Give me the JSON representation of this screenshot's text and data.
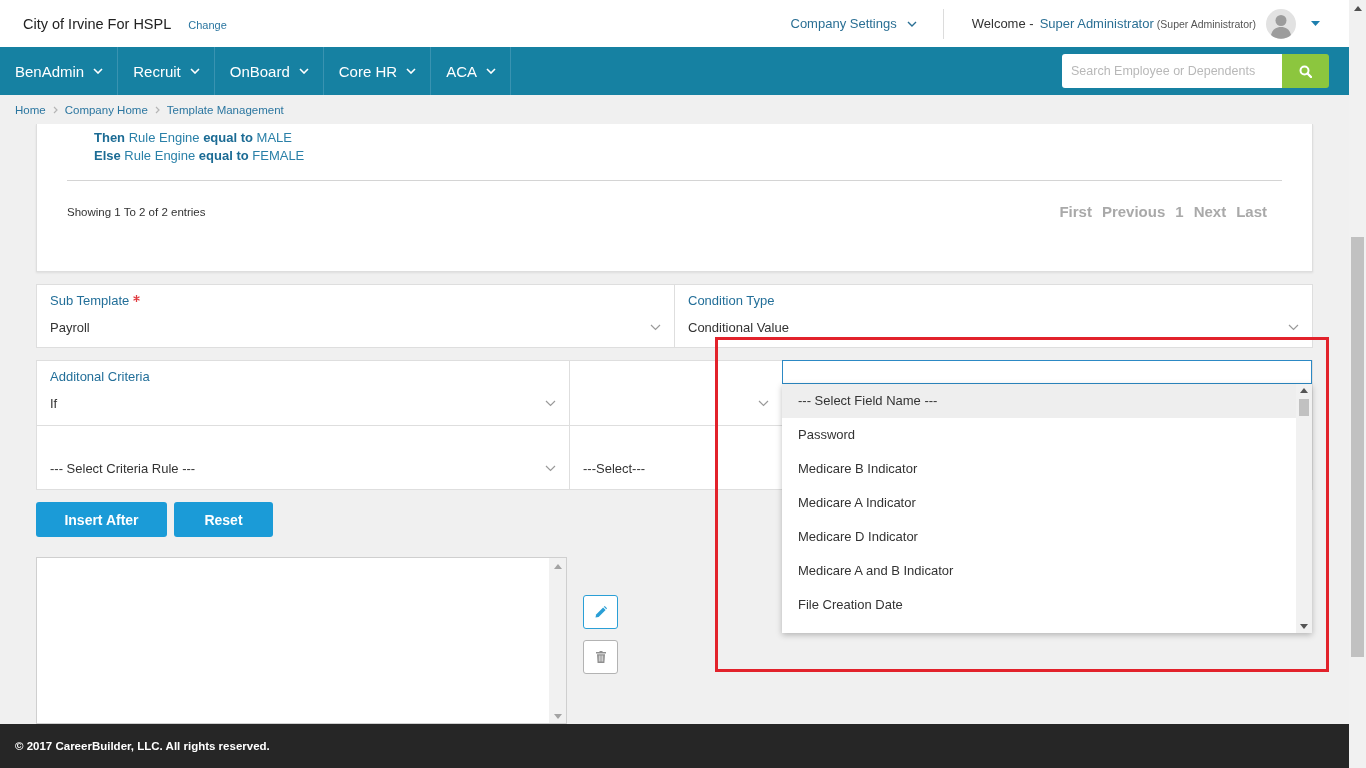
{
  "header": {
    "company": "City of Irvine For HSPL",
    "change_link": "Change",
    "settings_menu": "Company Settings",
    "welcome": "Welcome -",
    "user_name": "Super Administrator",
    "user_role": "(Super Administrator)"
  },
  "nav": {
    "items": [
      {
        "label": "BenAdmin"
      },
      {
        "label": "Recruit"
      },
      {
        "label": "OnBoard"
      },
      {
        "label": "Core HR"
      },
      {
        "label": "ACA"
      }
    ],
    "search": {
      "placeholder": "Search Employee or Dependents"
    }
  },
  "breadcrumb": [
    {
      "label": "Home"
    },
    {
      "label": "Company Home"
    },
    {
      "label": "Template Management"
    }
  ],
  "rules": {
    "lines": [
      "**Then** Rule Engine **equal to** MALE",
      "**Else** Rule Engine **equal to** FEMALE"
    ],
    "summary": "Showing 1 To 2 of 2 entries",
    "pagination": [
      {
        "label": "First",
        "disabled": true
      },
      {
        "label": "Previous",
        "disabled": true
      },
      {
        "label": "1",
        "disabled": true
      },
      {
        "label": "Next",
        "disabled": true
      },
      {
        "label": "Last",
        "disabled": true
      }
    ]
  },
  "form": {
    "sub_template": {
      "label": "Sub Template",
      "required": true,
      "value": "Payroll"
    },
    "condition_type": {
      "label": "Condition Type",
      "value": "Conditional Value"
    },
    "additional_criteria": {
      "label": "Additonal Criteria",
      "value": "If"
    },
    "field_name": {
      "expanded": true,
      "options": [
        {
          "label": "--- Select Field Name ---",
          "selected": true
        },
        {
          "label": "Password",
          "selected": false
        },
        {
          "label": "Medicare B Indicator",
          "selected": false
        },
        {
          "label": "Medicare A Indicator",
          "selected": false
        },
        {
          "label": "Medicare D Indicator",
          "selected": false
        },
        {
          "label": "Medicare A and B Indicator",
          "selected": false
        },
        {
          "label": "File Creation Date",
          "selected": false
        }
      ]
    },
    "criteria_rule": {
      "value": "--- Select Criteria Rule ---"
    },
    "criteria_value": {
      "value": "---Select---"
    }
  },
  "buttons": [
    {
      "label": "Insert After"
    },
    {
      "label": "Reset"
    }
  ],
  "footer": {
    "copyright": "© 2017 CareerBuilder, LLC. All rights reserved."
  }
}
